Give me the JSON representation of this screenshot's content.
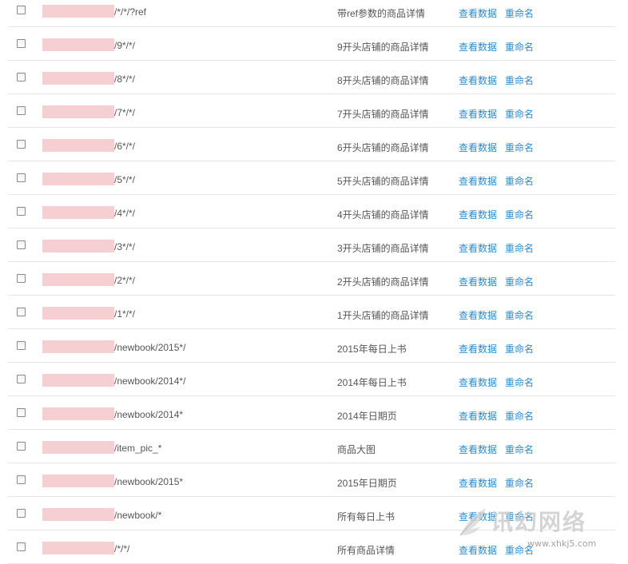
{
  "actions": {
    "view_label": "查看数据",
    "rename_label": "重命名"
  },
  "colors": {
    "link": "#2a8bd2",
    "text": "#555555",
    "redaction": "#f6cfd2",
    "divider": "#e6e6e6"
  },
  "rows": [
    {
      "pattern": "/*/*/?ref",
      "desc": "带ref参数的商品详情"
    },
    {
      "pattern": "/9*/*/",
      "desc": "9开头店铺的商品详情"
    },
    {
      "pattern": "/8*/*/",
      "desc": "8开头店铺的商品详情"
    },
    {
      "pattern": "/7*/*/",
      "desc": "7开头店铺的商品详情"
    },
    {
      "pattern": "/6*/*/",
      "desc": "6开头店铺的商品详情"
    },
    {
      "pattern": "/5*/*/",
      "desc": "5开头店铺的商品详情"
    },
    {
      "pattern": "/4*/*/",
      "desc": "4开头店铺的商品详情"
    },
    {
      "pattern": "/3*/*/",
      "desc": "3开头店铺的商品详情"
    },
    {
      "pattern": "/2*/*/",
      "desc": "2开头店铺的商品详情"
    },
    {
      "pattern": "/1*/*/",
      "desc": "1开头店铺的商品详情"
    },
    {
      "pattern": "/newbook/2015*/",
      "desc": "2015年每日上书"
    },
    {
      "pattern": "/newbook/2014*/",
      "desc": "2014年每日上书"
    },
    {
      "pattern": "/newbook/2014*",
      "desc": "2014年日期页"
    },
    {
      "pattern": "/item_pic_*",
      "desc": "商品大图"
    },
    {
      "pattern": "/newbook/2015*",
      "desc": "2015年日期页"
    },
    {
      "pattern": "/newbook/*",
      "desc": "所有每日上书"
    },
    {
      "pattern": "/*/*/",
      "desc": "所有商品详情"
    }
  ],
  "watermark": {
    "title": "讯幻网络",
    "url": "www.xhkj5.com",
    "icon": "feather-icon"
  }
}
